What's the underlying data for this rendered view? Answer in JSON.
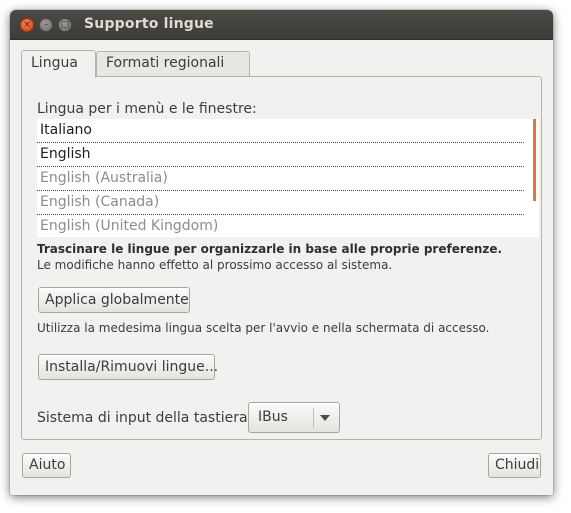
{
  "window": {
    "title": "Supporto lingue",
    "controls": {
      "close_glyph": "×",
      "minimize_glyph": "–",
      "maximize_glyph": "□"
    }
  },
  "tabs": [
    {
      "label": "Lingua",
      "active": true
    },
    {
      "label": "Formati regionali",
      "active": false
    }
  ],
  "language_panel": {
    "list_label": "Lingua per i menù e le finestre:",
    "languages": [
      {
        "label": "Italiano",
        "state": "active"
      },
      {
        "label": "English",
        "state": "active"
      },
      {
        "label": "English (Australia)",
        "state": "fallback"
      },
      {
        "label": "English (Canada)",
        "state": "fallback"
      },
      {
        "label": "English (United Kingdom)",
        "state": "fallback"
      }
    ],
    "hint_bold": "Trascinare le lingue per organizzarle in base alle proprie preferenze.",
    "hint": "Le modifiche hanno effetto al prossimo accesso al sistema.",
    "apply_button": "Applica globalmente",
    "apply_description": "Utilizza la medesima lingua scelta per l'avvio e nella schermata di accesso.",
    "install_button": "Installa/Rimuovi lingue...",
    "input_system_label": "Sistema di input della tastiera:",
    "input_system_value": "IBus"
  },
  "footer": {
    "help_button": "Aiuto",
    "close_button": "Chiudi"
  },
  "colors": {
    "titlebar": "#3d3c38",
    "title_text": "#dfdbd2",
    "window_bg": "#f2f1f0",
    "accent": "#e4743d",
    "close_button": "#e05a2b"
  }
}
